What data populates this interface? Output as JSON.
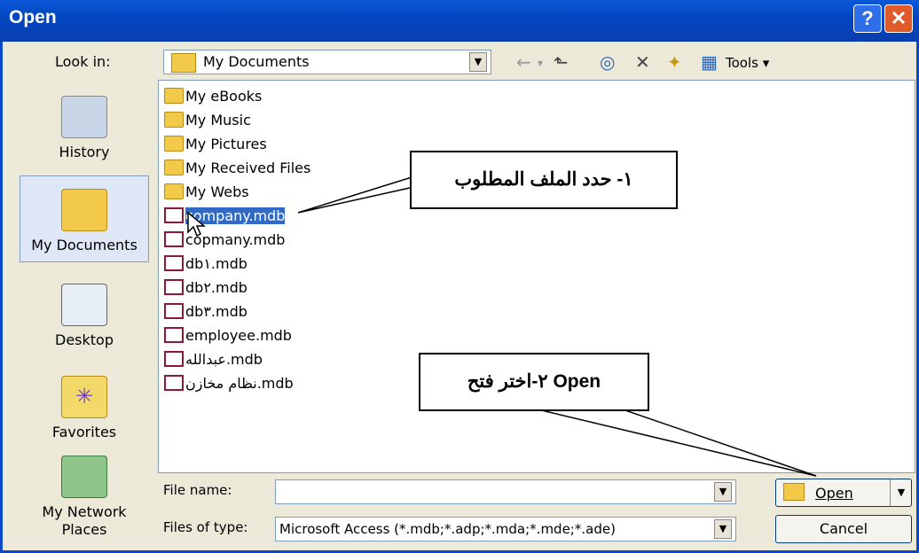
{
  "window": {
    "title": "Open",
    "help_glyph": "?",
    "close_glyph": "✕"
  },
  "toolbar": {
    "look_in_label": "Look in:",
    "look_in_value": "My Documents",
    "tools_label": "Tools ▾"
  },
  "places": [
    {
      "label": "History",
      "icon": "history-icon"
    },
    {
      "label": "My Documents",
      "icon": "my-documents-icon"
    },
    {
      "label": "Desktop",
      "icon": "desktop-icon"
    },
    {
      "label": "Favorites",
      "icon": "favorites-icon"
    },
    {
      "label": "My Network Places",
      "icon": "network-icon"
    }
  ],
  "files": [
    {
      "name": "My eBooks",
      "kind": "folder"
    },
    {
      "name": "My Music",
      "kind": "folder"
    },
    {
      "name": "My Pictures",
      "kind": "folder"
    },
    {
      "name": "My Received Files",
      "kind": "folder"
    },
    {
      "name": "My Webs",
      "kind": "folder"
    },
    {
      "name": "company.mdb",
      "kind": "mdb",
      "selected": true
    },
    {
      "name": "copmany.mdb",
      "kind": "mdb"
    },
    {
      "name": "db١.mdb",
      "kind": "mdb"
    },
    {
      "name": "db٢.mdb",
      "kind": "mdb"
    },
    {
      "name": "db٣.mdb",
      "kind": "mdb"
    },
    {
      "name": "employee.mdb",
      "kind": "mdb"
    },
    {
      "name": "عبدالله.mdb",
      "kind": "mdb"
    },
    {
      "name": "نظام مخازن.mdb",
      "kind": "mdb"
    }
  ],
  "callouts": {
    "step1": "١- حدد الملف المطلوب",
    "step2": "٢-اختر فتح Open"
  },
  "bottom": {
    "file_name_label": "File name:",
    "file_name_value": "",
    "files_of_type_label": "Files of type:",
    "files_of_type_value": "Microsoft Access (*.mdb;*.adp;*.mda;*.mde;*.ade)",
    "open_label": "Open",
    "cancel_label": "Cancel"
  },
  "colors": {
    "title_bar": "#0a58d8",
    "selection": "#316ac5",
    "window_bg": "#ece9d8"
  }
}
